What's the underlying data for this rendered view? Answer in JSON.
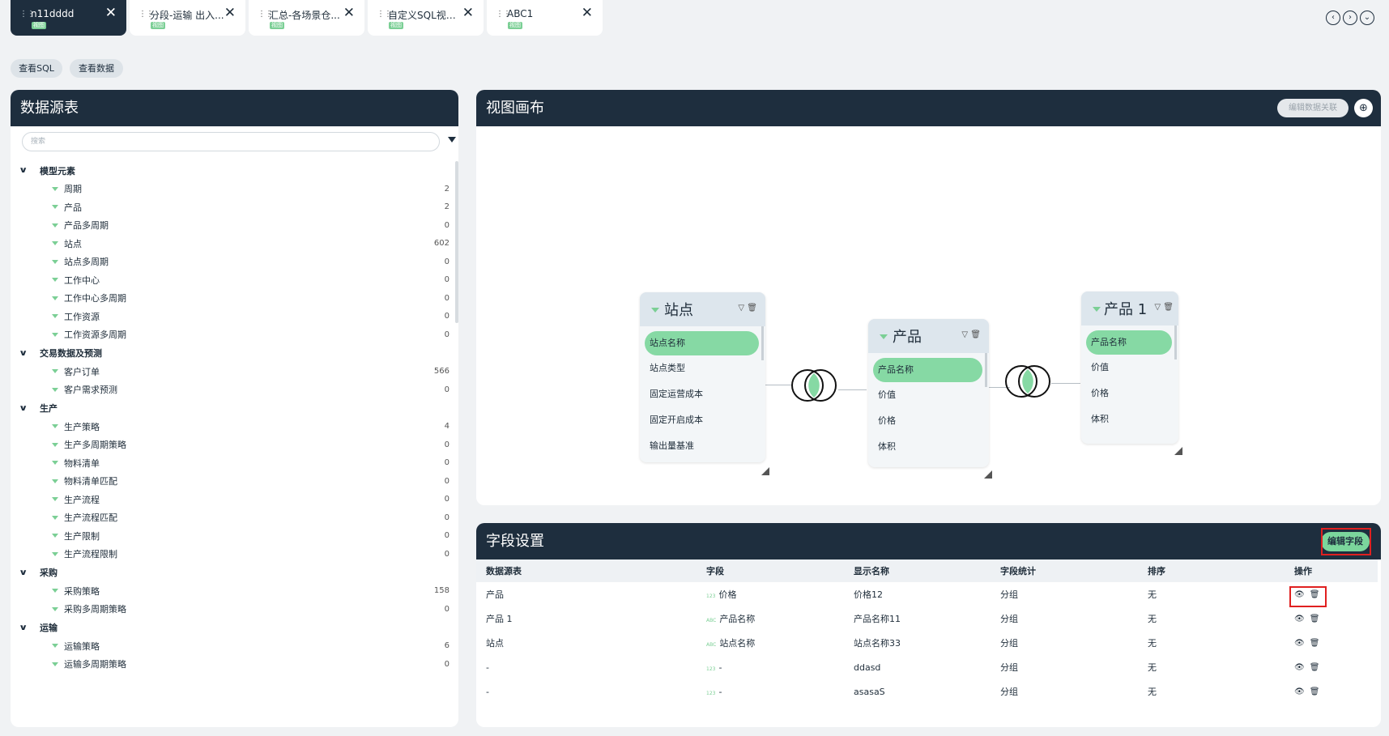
{
  "tabs": [
    {
      "label": "n11dddd",
      "sub": "视图",
      "active": true
    },
    {
      "label": "分段-运输 出入...",
      "sub": "视图"
    },
    {
      "label": "汇总-各场景仓...",
      "sub": "视图"
    },
    {
      "label": "自定义SQL视图...",
      "sub": "视图"
    },
    {
      "label": "ABC1",
      "sub": "视图"
    }
  ],
  "nav": {
    "prev": "‹",
    "next": "›",
    "down": "⌄"
  },
  "toolbar": {
    "view_sql": "查看SQL",
    "view_data": "查看数据"
  },
  "left": {
    "title": "数据源表",
    "search_placeholder": "搜索",
    "groups": [
      {
        "name": "模型元素",
        "items": [
          {
            "label": "周期",
            "count": "2"
          },
          {
            "label": "产品",
            "count": "2"
          },
          {
            "label": "产品多周期",
            "count": "0"
          },
          {
            "label": "站点",
            "count": "602"
          },
          {
            "label": "站点多周期",
            "count": "0"
          },
          {
            "label": "工作中心",
            "count": "0"
          },
          {
            "label": "工作中心多周期",
            "count": "0"
          },
          {
            "label": "工作资源",
            "count": "0"
          },
          {
            "label": "工作资源多周期",
            "count": "0"
          }
        ]
      },
      {
        "name": "交易数据及预测",
        "items": [
          {
            "label": "客户订单",
            "count": "566"
          },
          {
            "label": "客户需求预测",
            "count": "0"
          }
        ]
      },
      {
        "name": "生产",
        "items": [
          {
            "label": "生产策略",
            "count": "4"
          },
          {
            "label": "生产多周期策略",
            "count": "0"
          },
          {
            "label": "物料清单",
            "count": "0"
          },
          {
            "label": "物料清单匹配",
            "count": "0"
          },
          {
            "label": "生产流程",
            "count": "0"
          },
          {
            "label": "生产流程匹配",
            "count": "0"
          },
          {
            "label": "生产限制",
            "count": "0"
          },
          {
            "label": "生产流程限制",
            "count": "0"
          }
        ]
      },
      {
        "name": "采购",
        "items": [
          {
            "label": "采购策略",
            "count": "158"
          },
          {
            "label": "采购多周期策略",
            "count": "0"
          }
        ]
      },
      {
        "name": "运输",
        "items": [
          {
            "label": "运输策略",
            "count": "6"
          },
          {
            "label": "运输多周期策略",
            "count": "0"
          }
        ]
      }
    ]
  },
  "canvas": {
    "title": "视图画布",
    "edit_relation": "编辑数据关联",
    "nodes": [
      {
        "title": "站点",
        "fields": [
          "站点名称",
          "站点类型",
          "固定运营成本",
          "固定开启成本",
          "输出量基准"
        ],
        "selected": 0
      },
      {
        "title": "产品",
        "fields": [
          "产品名称",
          "价值",
          "价格",
          "体积"
        ],
        "selected": 0
      },
      {
        "title": "产品 1",
        "fields": [
          "产品名称",
          "价值",
          "价格",
          "体积"
        ],
        "selected": 0
      }
    ],
    "venn_color": "#86d9a4"
  },
  "fields": {
    "title": "字段设置",
    "edit_button": "编辑字段",
    "columns": [
      "数据源表",
      "字段",
      "显示名称",
      "字段统计",
      "排序",
      "操作"
    ],
    "rows": [
      {
        "source": "产品",
        "type": "123",
        "field": "价格",
        "display": "价格12",
        "stat": "分组",
        "sort": "无"
      },
      {
        "source": "产品 1",
        "type": "ABC",
        "field": "产品名称",
        "display": "产品名称11",
        "stat": "分组",
        "sort": "无"
      },
      {
        "source": "站点",
        "type": "ABC",
        "field": "站点名称",
        "display": "站点名称33",
        "stat": "分组",
        "sort": "无"
      },
      {
        "source": "-",
        "type": "123",
        "field": "-",
        "display": "ddasd",
        "stat": "分组",
        "sort": "无"
      },
      {
        "source": "-",
        "type": "123",
        "field": "-",
        "display": "asasaS",
        "stat": "分组",
        "sort": "无"
      }
    ]
  },
  "colors": {
    "dark": "#1e2e3e",
    "accent": "#7bcf95",
    "highlight": "#e02020"
  }
}
